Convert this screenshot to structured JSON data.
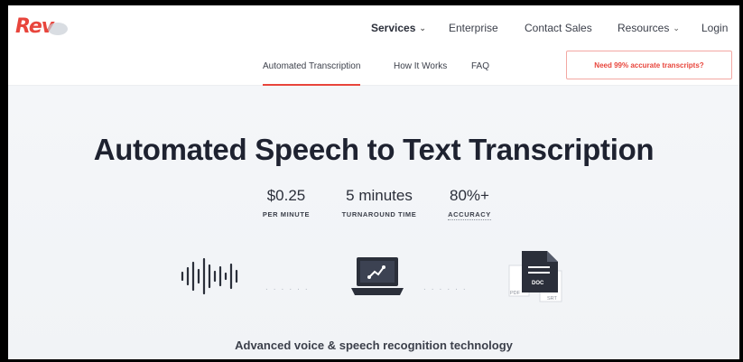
{
  "brand": {
    "logo_text": "Rev"
  },
  "nav": {
    "services": "Services",
    "enterprise": "Enterprise",
    "contact_sales": "Contact Sales",
    "resources": "Resources",
    "login": "Login"
  },
  "subnav": {
    "automated_transcription": "Automated Transcription",
    "how_it_works": "How It Works",
    "faq": "FAQ",
    "cta": "Need 99% accurate transcripts?"
  },
  "hero": {
    "title": "Automated Speech to Text Transcription",
    "stats": [
      {
        "value": "$0.25",
        "label": "PER MINUTE"
      },
      {
        "value": "5 minutes",
        "label": "TURNAROUND TIME"
      },
      {
        "value": "80%+",
        "label": "ACCURACY"
      }
    ],
    "dots": "......",
    "doc_labels": {
      "main": "DOC",
      "left": "PDF",
      "right": "SRT"
    },
    "tagline": "Advanced voice & speech recognition technology"
  },
  "colors": {
    "accent": "#e8453c",
    "text_dark": "#1e2230",
    "hero_bg": "#f4f6f9"
  },
  "icons": [
    "chevron-down-icon",
    "sound-wave-icon",
    "laptop-icon",
    "document-icon"
  ]
}
